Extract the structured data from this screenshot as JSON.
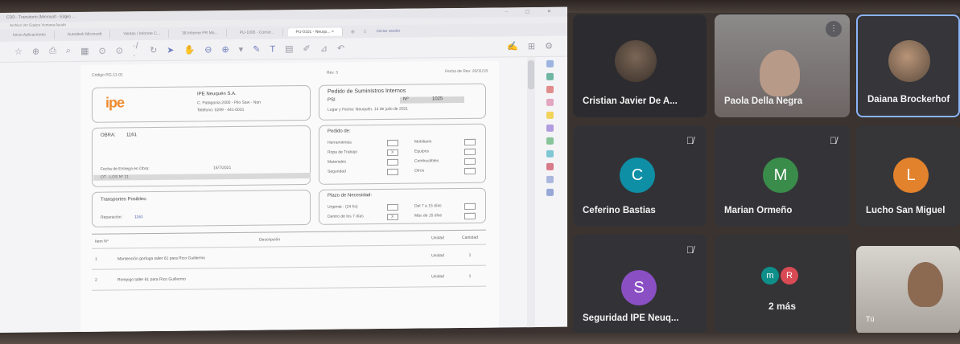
{
  "document_window": {
    "title_bar": "CDD - Transitorio (Microsoft - Edge) ...",
    "menu_bar": "Archivo  Ver  Equipo  Ventana  Ayuda",
    "tabs": [
      {
        "label": "Inicio Aplicaciones"
      },
      {
        "label": "Autodesk Microsoft"
      },
      {
        "label": "Ventas / Informe C..."
      },
      {
        "label": "38 Informe PR Mo..."
      },
      {
        "label": "PU-1095 - Constr..."
      },
      {
        "label": "PU-0101 - Neuqu...",
        "active": true
      }
    ],
    "tab_close": "×",
    "tab_add": "⊕",
    "login_label": "Iniciar sesión"
  },
  "document": {
    "code": "Código RG-11-01",
    "revision": "Rev. 3",
    "date_label": "Fecha de Rev: 20/11/18",
    "company": {
      "logo_text": "ipe",
      "name": "IPE Neuquén S.A.",
      "address": "C. Patagonia 2000 - Pilo Saw - Nqn",
      "phone": "Teléfono: 0299 - 441-0001"
    },
    "pedido": {
      "title": "Pedido de Suministros Internos",
      "psi_label": "PSI",
      "number_label": "Nº",
      "number": "1025",
      "place_date": "Lugar y Fecha:  Neuquén, 14 de julio de 2021"
    },
    "obra": {
      "obra_label": "OBRA:",
      "obra_value": "1161",
      "delivery_label": "Fecha de Entrega en Obra:",
      "delivery_value": "15/7/2021",
      "highlight": "OT - LOS Nº 21"
    },
    "pedido_de": {
      "title": "Pedido de:",
      "items_left": [
        "Herramientas",
        "Ropa de Trabajo",
        "Materiales",
        "Seguridad"
      ],
      "items_right": [
        "Mobiliario",
        "Equipos",
        "Combustibles",
        "Otros"
      ],
      "checked": "X"
    },
    "transport": {
      "title": "Transportes Posibles:",
      "repair_label": "Reparación:",
      "repair_value": "1161"
    },
    "plazo": {
      "title": "Plazo de Necesidad:",
      "urgent": "Urgente : (24 hs)",
      "within_7": "Dentro de los 7 días",
      "between": "Del 7 a 15 días",
      "more": "Más de 15 días",
      "checked": "X"
    },
    "table": {
      "headers": [
        "Item Nº",
        "Descripción",
        "Unidad",
        "Cantidad"
      ],
      "rows": [
        {
          "item": "1",
          "desc": "Mantención gorfuga taller 61 para Rico Guillermo",
          "unit": "Unidad",
          "qty": "1"
        },
        {
          "item": "2",
          "desc": "Rompigo taller 61 para Rico Guillermo",
          "unit": "Unidad",
          "qty": "1"
        }
      ]
    }
  },
  "participants": [
    {
      "name": "Cristian Javier De A...",
      "type": "photo"
    },
    {
      "name": "Paola Della Negra",
      "type": "video"
    },
    {
      "name": "Daiana Brockerhof",
      "type": "photo"
    },
    {
      "name": "Ceferino Bastias",
      "initial": "C",
      "color": "#0e8fa6"
    },
    {
      "name": "Marian Ormeño",
      "initial": "M",
      "color": "#3a8c4a"
    },
    {
      "name": "Lucho San Miguel",
      "initial": "L",
      "color": "#e3822c"
    },
    {
      "name": "Seguridad IPE Neuq...",
      "initial": "S",
      "color": "#8b4fc4"
    },
    {
      "name": "2 más",
      "minis": [
        "m",
        "R"
      ],
      "mini_colors": [
        "#0e8f8a",
        "#d84a54"
      ]
    },
    {
      "name": "Tú",
      "type": "self"
    }
  ]
}
